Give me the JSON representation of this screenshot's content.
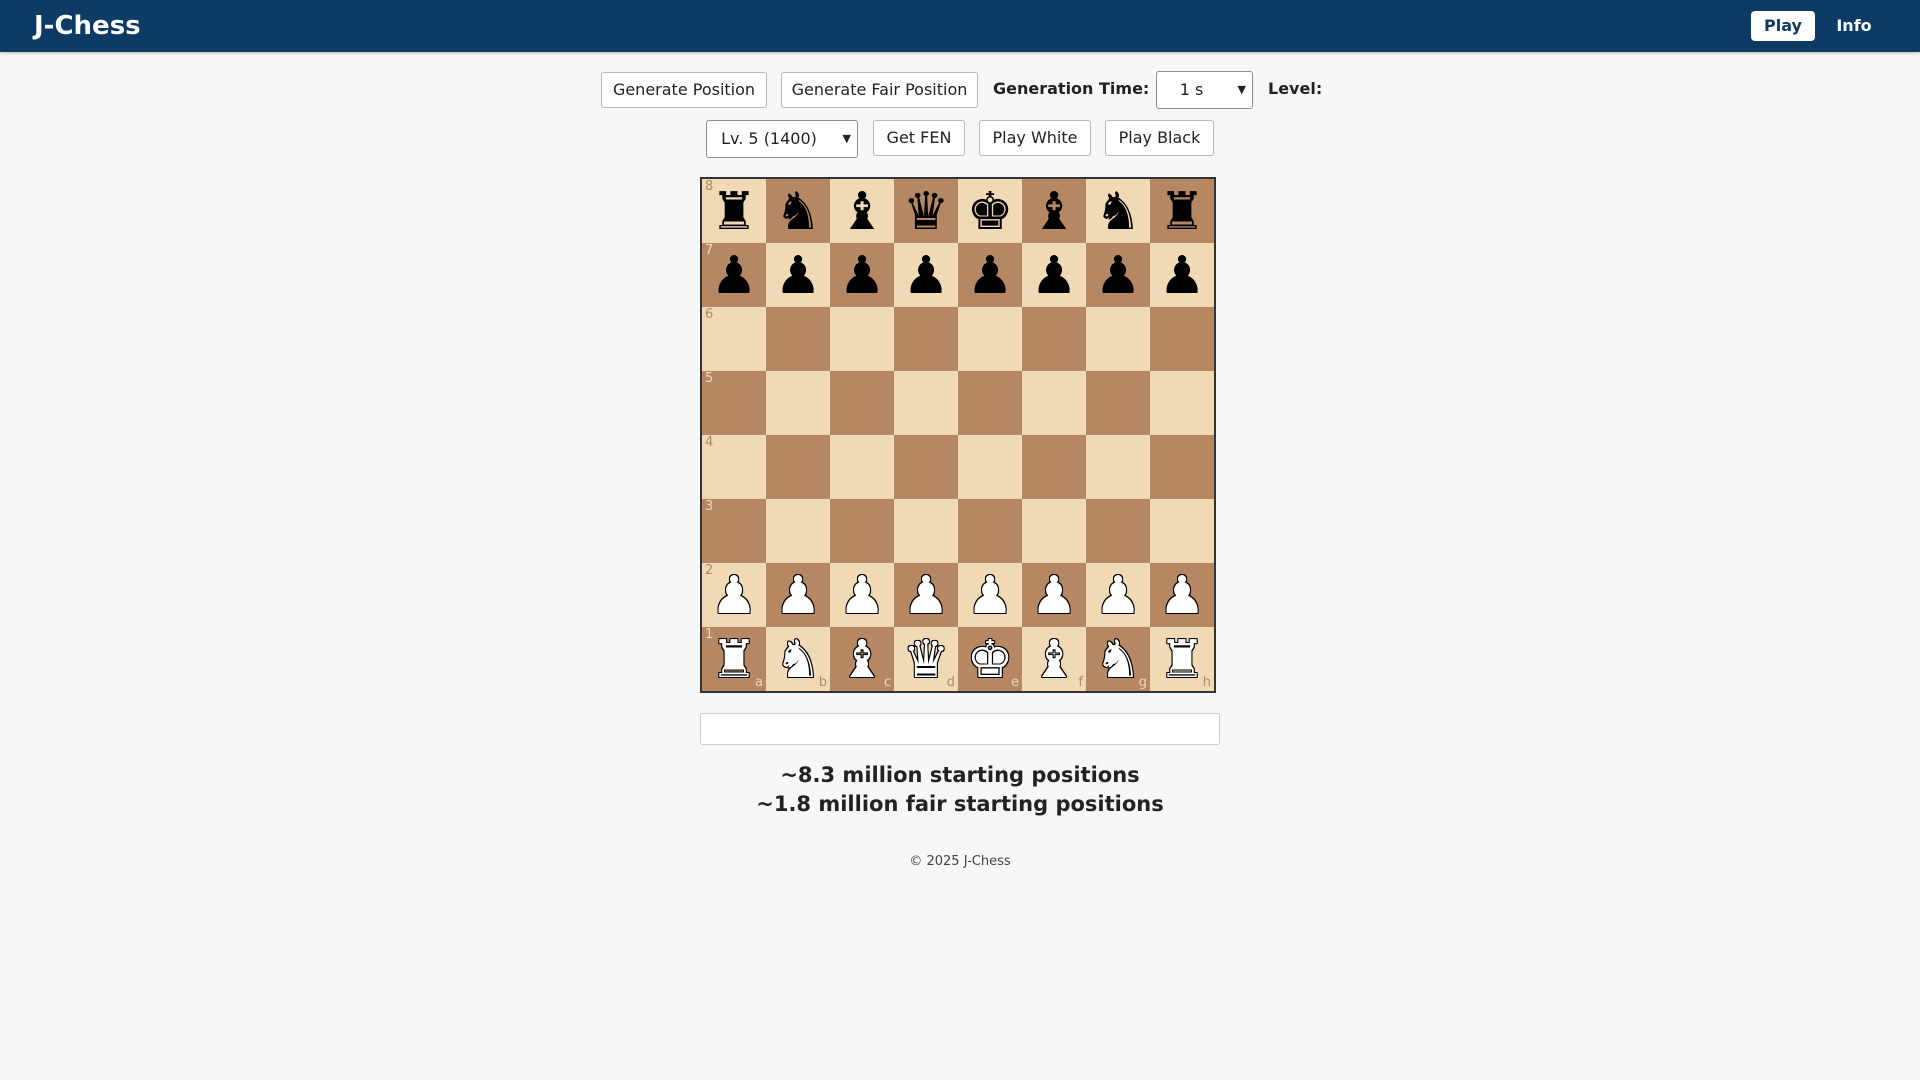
{
  "header": {
    "title": "J-Chess",
    "nav": {
      "play": "Play",
      "info": "Info"
    }
  },
  "toolbar": {
    "generate_position": "Generate Position",
    "generate_fair_position": "Generate Fair Position",
    "generation_time_label": "Generation Time:",
    "generation_time_value": "1 s",
    "level_label": "Level:",
    "level_value": "Lv. 5 (1400)",
    "get_fen": "Get FEN",
    "play_white": "Play White",
    "play_black": "Play Black"
  },
  "board": {
    "ranks": [
      "8",
      "7",
      "6",
      "5",
      "4",
      "3",
      "2",
      "1"
    ],
    "files": [
      "a",
      "b",
      "c",
      "d",
      "e",
      "f",
      "g",
      "h"
    ],
    "position": [
      [
        "br",
        "bn",
        "bb",
        "bq",
        "bk",
        "bb",
        "bn",
        "br"
      ],
      [
        "bp",
        "bp",
        "bp",
        "bp",
        "bp",
        "bp",
        "bp",
        "bp"
      ],
      [
        "",
        "",
        "",
        "",
        "",
        "",
        "",
        ""
      ],
      [
        "",
        "",
        "",
        "",
        "",
        "",
        "",
        ""
      ],
      [
        "",
        "",
        "",
        "",
        "",
        "",
        "",
        ""
      ],
      [
        "",
        "",
        "",
        "",
        "",
        "",
        "",
        ""
      ],
      [
        "wp",
        "wp",
        "wp",
        "wp",
        "wp",
        "wp",
        "wp",
        "wp"
      ],
      [
        "wr",
        "wn",
        "wb",
        "wq",
        "wk",
        "wb",
        "wn",
        "wr"
      ]
    ],
    "colors": {
      "light": "#f0d9b5",
      "dark": "#b58863"
    }
  },
  "fen_output": {
    "value": ""
  },
  "stats": {
    "line1": "~8.3 million starting positions",
    "line2": "~1.8 million fair starting positions"
  },
  "footer": {
    "text": "© 2025 J-Chess"
  },
  "theme": {
    "header_bg": "#0d3b66",
    "page_bg": "#f7f7f7"
  }
}
